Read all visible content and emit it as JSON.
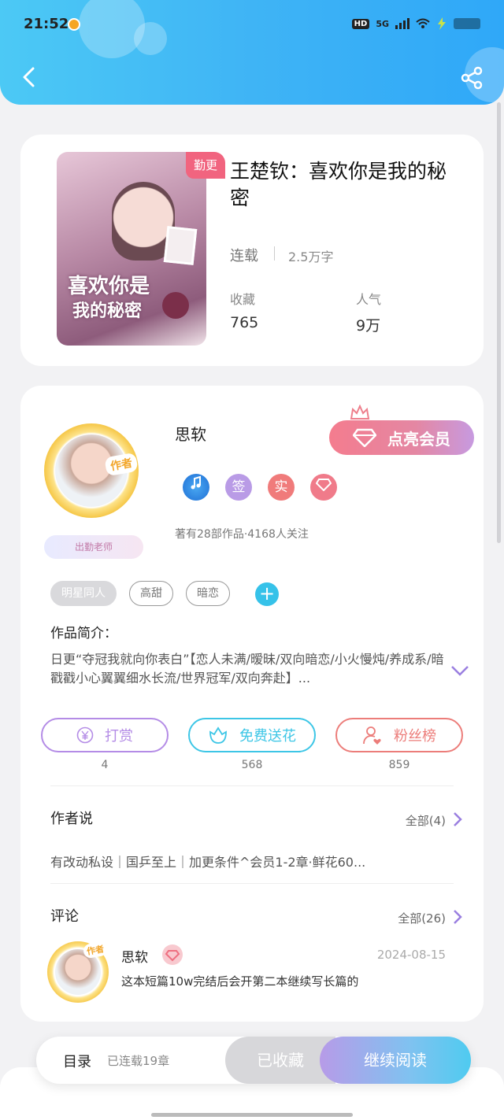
{
  "status_bar": {
    "time": "21:52",
    "hd": "HD",
    "network": "5G"
  },
  "book": {
    "update_badge": "勤更",
    "cover_text_line1": "喜欢你是",
    "cover_text_line2": "我的秘密",
    "title": "王楚钦：喜欢你是我的秘密",
    "status": "连载",
    "word_count": "2.5万字",
    "favorites_label": "收藏",
    "favorites_value": "765",
    "popularity_label": "人气",
    "popularity_value": "9万"
  },
  "author": {
    "badge": "作者",
    "tutor_label": "出勤老师",
    "name": "思软",
    "vip_button": "点亮会员",
    "badges": [
      "签",
      "实"
    ],
    "works_info": "著有28部作品·4168人关注"
  },
  "tags": [
    "明星同人",
    "高甜",
    "暗恋"
  ],
  "intro": {
    "label": "作品简介：",
    "text": "日更“夺冠我就向你表白”【恋人未满/暧昧/双向暗恋/小火慢炖/养成系/暗戳戳小心翼翼细水长流/世界冠军/双向奔赴】..."
  },
  "actions": {
    "reward": {
      "label": "打赏",
      "count": "4",
      "icon": "yen-icon"
    },
    "flower": {
      "label": "免费送花",
      "count": "568",
      "icon": "flower-icon"
    },
    "fans": {
      "label": "粉丝榜",
      "count": "859",
      "icon": "fan-person-icon"
    }
  },
  "author_says": {
    "title": "作者说",
    "more": "全部(4)",
    "text": "有改动私设｜国乒至上｜加更条件^会员1-2章·鲜花60..."
  },
  "comments": {
    "title": "评论",
    "more": "全部(26)",
    "item": {
      "badge": "作者",
      "name": "思软",
      "date": "2024-08-15",
      "text": "这本短篇10w完结后会开第二本继续写长篇的"
    }
  },
  "bottom_bar": {
    "toc": "目录",
    "chapters": "已连载19章",
    "collected": "已收藏",
    "continue": "继续阅读"
  },
  "colors": {
    "header": "#3fb4f5",
    "vip_gradient_start": "#f47c8e",
    "reward": "#b48ce6",
    "flower": "#3dc6e6",
    "fans": "#ec7d7a"
  }
}
